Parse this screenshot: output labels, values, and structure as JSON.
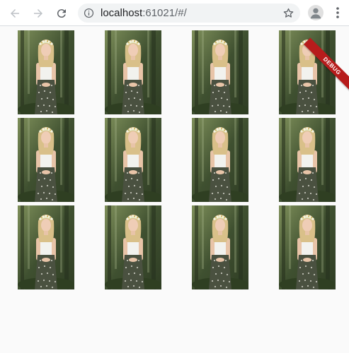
{
  "browser": {
    "url_host": "localhost",
    "url_rest": ":61021/#/",
    "icons": {
      "back": "arrow-left-icon",
      "forward": "arrow-right-icon",
      "reload": "reload-icon",
      "info": "info-icon",
      "bookmark": "star-icon",
      "profile": "account-icon",
      "menu": "more-vert-icon"
    }
  },
  "app": {
    "debug_banner": "DEBUG",
    "photo_count": 12,
    "photos": [
      {
        "subject": "woman-flower-crown"
      },
      {
        "subject": "woman-flower-crown"
      },
      {
        "subject": "woman-flower-crown"
      },
      {
        "subject": "woman-flower-crown"
      },
      {
        "subject": "woman-flower-crown"
      },
      {
        "subject": "woman-flower-crown"
      },
      {
        "subject": "woman-flower-crown"
      },
      {
        "subject": "woman-flower-crown"
      },
      {
        "subject": "woman-flower-crown"
      },
      {
        "subject": "woman-flower-crown"
      },
      {
        "subject": "woman-flower-crown"
      },
      {
        "subject": "woman-flower-crown"
      }
    ]
  },
  "colors": {
    "banner": "#b71c1c",
    "forest_dark": "#2f3d24",
    "forest_light": "#7e8f5a",
    "top_white": "#f2f2ee",
    "skirt": "#4a5140"
  }
}
